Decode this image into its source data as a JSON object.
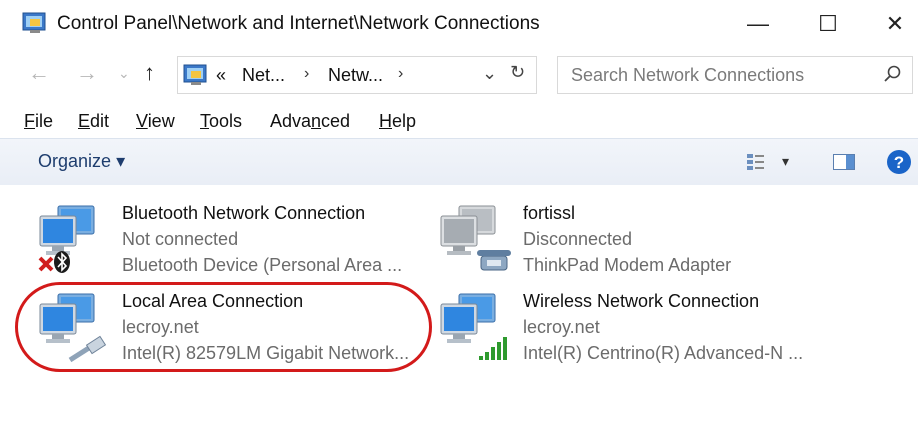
{
  "window": {
    "title": "Control Panel\\Network and Internet\\Network Connections",
    "minimize": "—",
    "maximize": "☐",
    "close": "✕"
  },
  "nav": {
    "back": "←",
    "forward": "→",
    "recent": "⌄",
    "up": "↑"
  },
  "address": {
    "overflow": "«",
    "crumbs": [
      "Net...",
      "Netw..."
    ],
    "sep": "›",
    "dropdown": "⌄",
    "refresh": "↻"
  },
  "search": {
    "placeholder": "Search Network Connections"
  },
  "menu": [
    {
      "label": "File",
      "key": "F",
      "rest": "ile"
    },
    {
      "label": "Edit",
      "key": "E",
      "rest": "dit"
    },
    {
      "label": "View",
      "key": "V",
      "rest": "iew"
    },
    {
      "label": "Tools",
      "key": "T",
      "rest": "ools"
    },
    {
      "label": "Advanced",
      "pre": "Adva",
      "key": "n",
      "rest": "ced"
    },
    {
      "label": "Help",
      "key": "H",
      "rest": "elp"
    }
  ],
  "toolbar": {
    "organize": "Organize",
    "organize_caret": "▾",
    "view_caret": "▾"
  },
  "connections": [
    {
      "name": "Bluetooth Network Connection",
      "status": "Not connected",
      "device": "Bluetooth Device (Personal Area ...",
      "icon": "network-computers-icon",
      "overlay": "bluetooth-icon",
      "error": true
    },
    {
      "name": "fortissl",
      "status": "Disconnected",
      "device": "ThinkPad Modem Adapter",
      "icon": "network-computers-icon",
      "overlay": "modem-phone-icon",
      "error": false
    },
    {
      "name": "Local Area Connection",
      "status": "lecroy.net",
      "device": "Intel(R) 82579LM Gigabit Network...",
      "icon": "network-computers-icon",
      "overlay": "ethernet-cable-icon",
      "error": false
    },
    {
      "name": "Wireless Network Connection",
      "status": "lecroy.net",
      "device": "Intel(R) Centrino(R) Advanced-N ...",
      "icon": "network-computers-icon",
      "overlay": "signal-bars-icon",
      "error": false
    }
  ],
  "colors": {
    "highlight": "#d31a1a",
    "toolbar_text": "#1e3d6e",
    "help": "#1a64c8",
    "signal": "#2e9a2e"
  }
}
